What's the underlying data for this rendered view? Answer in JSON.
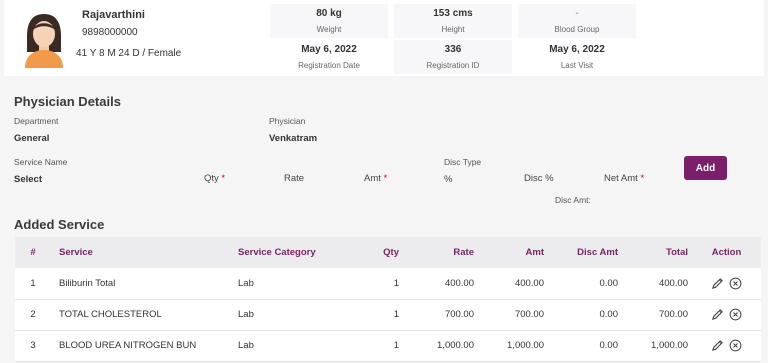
{
  "patient": {
    "name": "Rajavarthini",
    "phone": "9898000000",
    "age_gender": "41 Y 8 M 24 D / Female",
    "avatar_icon": "female-avatar-icon",
    "stats": [
      {
        "value": "80 kg",
        "label": "Weight"
      },
      {
        "value": "153 cms",
        "label": "Height"
      },
      {
        "value": "-",
        "label": "Blood Group"
      },
      {
        "value": "May 6, 2022",
        "label": "Registration Date"
      },
      {
        "value": "336",
        "label": "Registration ID"
      },
      {
        "value": "May 6, 2022",
        "label": "Last Visit"
      }
    ]
  },
  "physician": {
    "title": "Physician Details",
    "department_label": "Department",
    "department_value": "General",
    "physician_label": "Physician",
    "physician_value": "Venkatram"
  },
  "service_form": {
    "service_name_label": "Service Name",
    "service_select": "Select",
    "qty": "Qty",
    "rate": "Rate",
    "amt": "Amt",
    "disc_type_label": "Disc Type",
    "disc_type_value": "%",
    "disc_pct": "Disc %",
    "net_amt": "Net Amt",
    "disc_amt": "Disc Amt:",
    "required_mark": "*",
    "add_button": "Add"
  },
  "added_service": {
    "title": "Added Service",
    "columns": [
      "#",
      "Service",
      "Service Category",
      "Qty",
      "Rate",
      "Amt",
      "Disc Amt",
      "Total",
      "Action"
    ],
    "rows": [
      {
        "n": "1",
        "service": "Biliburin Total",
        "category": "Lab",
        "qty": "1",
        "rate": "400.00",
        "amt": "400.00",
        "disc": "0.00",
        "total": "400.00"
      },
      {
        "n": "2",
        "service": "TOTAL CHOLESTEROL",
        "category": "Lab",
        "qty": "1",
        "rate": "700.00",
        "amt": "700.00",
        "disc": "0.00",
        "total": "700.00"
      },
      {
        "n": "3",
        "service": "BLOOD UREA NITROGEN BUN",
        "category": "Lab",
        "qty": "1",
        "rate": "1,000.00",
        "amt": "1,000.00",
        "disc": "0.00",
        "total": "1,000.00"
      }
    ],
    "action_icons": [
      "edit-pencil-icon",
      "remove-circle-x-icon"
    ]
  },
  "colors": {
    "accent": "#7b1f6a",
    "required": "#d0021b",
    "header_bg": "#ececee",
    "page_bg": "#f5f5f6"
  }
}
